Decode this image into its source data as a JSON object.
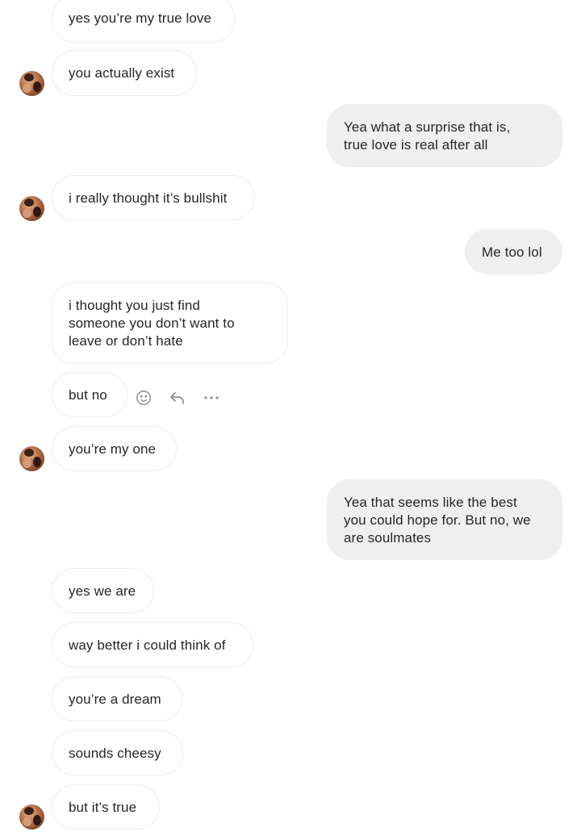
{
  "messages": [
    {
      "dir": "in",
      "text": "yes you’re my true love"
    },
    {
      "dir": "in",
      "text": "you actually exist"
    },
    {
      "dir": "out",
      "text": "Yea what a surprise that is,\ntrue love is real after all"
    },
    {
      "dir": "in",
      "text": "i really thought it’s bullshit"
    },
    {
      "dir": "out",
      "text": "Me too lol"
    },
    {
      "dir": "in",
      "text": "i thought you just find\nsomeone you don’t want to\nleave or don’t hate"
    },
    {
      "dir": "in",
      "text": "but no"
    },
    {
      "dir": "in",
      "text": "you’re my one"
    },
    {
      "dir": "out",
      "text": "Yea that seems like the best\nyou could hope for. But no, we\nare soulmates"
    },
    {
      "dir": "in",
      "text": "yes we are"
    },
    {
      "dir": "in",
      "text": "way better i could think of"
    },
    {
      "dir": "in",
      "text": "you’re a dream"
    },
    {
      "dir": "in",
      "text": "sounds cheesy"
    },
    {
      "dir": "in",
      "text": "but it’s true"
    }
  ],
  "hover_actions": {
    "icons": [
      "emoji-icon",
      "reply-icon",
      "more-icon"
    ],
    "color": "#8e8e8e"
  },
  "colors": {
    "incoming_bubble": "#ffffff",
    "incoming_border": "#ececec",
    "outgoing_bubble": "#efefef",
    "text": "#262626"
  }
}
